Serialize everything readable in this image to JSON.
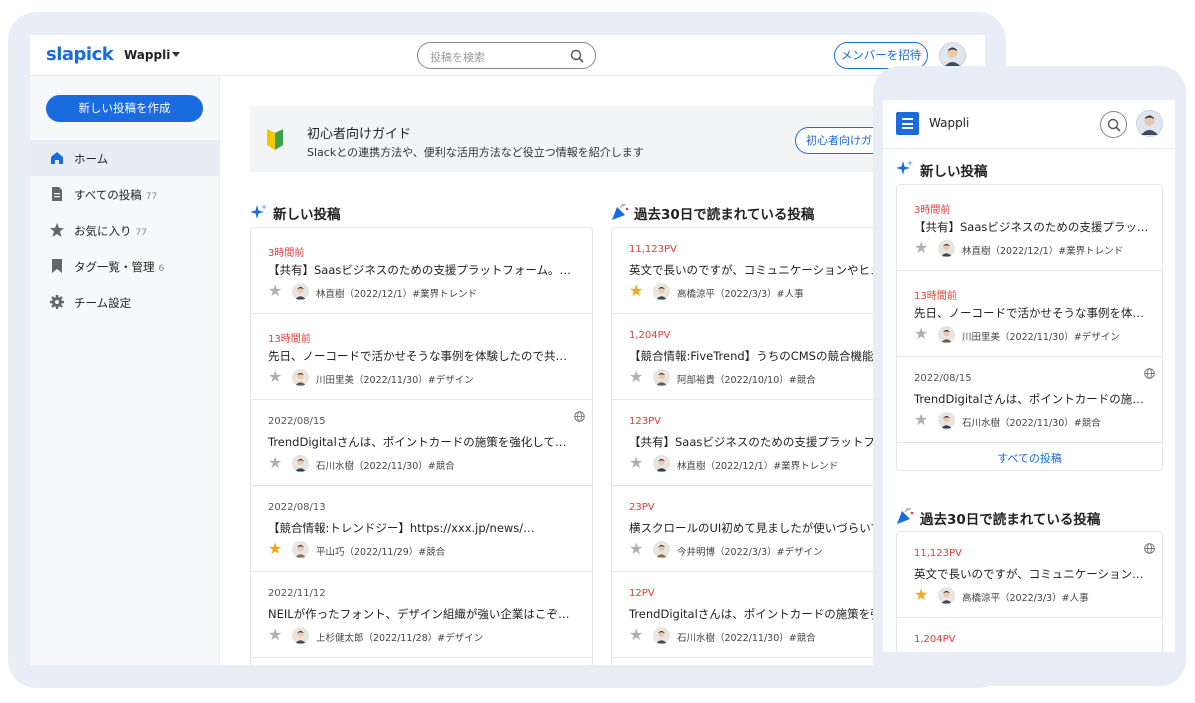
{
  "colors": {
    "brand": "#1a6be0",
    "recent_red": "#e03b3b",
    "star_on": "#f0a81c",
    "star_off": "#b0b0b0"
  },
  "desktop": {
    "logo": "slapick",
    "workspace": "Wappli",
    "search_placeholder": "投稿を検索",
    "invite_label": "メンバーを招待",
    "sidebar": {
      "new_post_label": "新しい投稿を作成",
      "items": [
        {
          "label": "ホーム",
          "count": "",
          "icon": "home-icon",
          "active": true
        },
        {
          "label": "すべての投稿",
          "count": "77",
          "icon": "document-icon",
          "active": false
        },
        {
          "label": "お気に入り",
          "count": "77",
          "icon": "star-icon",
          "active": false
        },
        {
          "label": "タグ一覧・管理",
          "count": "6",
          "icon": "bookmark-icon",
          "active": false
        },
        {
          "label": "チーム設定",
          "count": "",
          "icon": "gear-icon",
          "active": false
        }
      ]
    },
    "guide": {
      "title": "初心者向けガイド",
      "subtitle": "Slackとの連携方法や、便利な活用方法など役立つ情報を紹介します",
      "button_label": "初心者向けガイドを見る"
    },
    "new_posts": {
      "title": "新しい投稿",
      "items": [
        {
          "meta": "3時間前",
          "red": true,
          "title": "【共有】Saasビジネスのための支援プラットフォーム。…",
          "starred": false,
          "byline": "林直樹（2022/12/1）#業界トレンド",
          "globe": false
        },
        {
          "meta": "13時間前",
          "red": true,
          "title": "先日、ノーコードで活かせそうな事例を体験したので共有します。…",
          "starred": false,
          "byline": "川田里美（2022/11/30）#デザイン",
          "globe": false
        },
        {
          "meta": "2022/08/15",
          "red": false,
          "title": "TrendDigitalさんは、ポイントカードの施策を強化しているん…",
          "starred": false,
          "byline": "石川水樹（2022/11/30）#競合",
          "globe": true
        },
        {
          "meta": "2022/08/13",
          "red": false,
          "title": "【競合情報:トレンドジー】https://xxx.jp/news/…",
          "starred": true,
          "byline": "平山巧（2022/11/29）#競合",
          "globe": false
        },
        {
          "meta": "2022/11/12",
          "red": false,
          "title": "NEILが作ったフォント、デザイン組織が強い企業はこぞって作っ…",
          "starred": false,
          "byline": "上杉健太郎（2022/11/28）#デザイン",
          "globe": false
        }
      ]
    },
    "popular_posts": {
      "title": "過去30日で読まれている投稿",
      "items": [
        {
          "meta": "11,123PV",
          "red": true,
          "title": "英文で長いのですが、コミュニケーションやヒューマン",
          "starred": true,
          "byline": "高橋涼平（2022/3/3）#人事"
        },
        {
          "meta": "1,204PV",
          "red": true,
          "title": "【競合情報:FiveTrend】うちのCMSの競合機能とし",
          "starred": false,
          "byline": "阿部裕貴（2022/10/10）#競合"
        },
        {
          "meta": "123PV",
          "red": true,
          "title": "【共有】Saasビジネスのための支援プラットフォーム。",
          "starred": false,
          "byline": "林直樹（2022/12/1）#業界トレンド"
        },
        {
          "meta": "23PV",
          "red": true,
          "title": "横スクロールのUI初めて見ましたが使いづらいですよ",
          "starred": false,
          "byline": "今井明博（2022/3/3）#デザイン"
        },
        {
          "meta": "12PV",
          "red": true,
          "title": "TrendDigitalさんは、ポイントカードの施策を強化し",
          "starred": false,
          "byline": "石川水樹（2022/11/30）#競合"
        }
      ]
    }
  },
  "mobile": {
    "workspace": "Wappli",
    "new_posts": {
      "title": "新しい投稿",
      "items": [
        {
          "meta": "3時間前",
          "red": true,
          "title": "【共有】Saasビジネスのための支援プラットフォ…",
          "starred": false,
          "byline": "林直樹（2022/12/1）#業界トレンド",
          "globe": false
        },
        {
          "meta": "13時間前",
          "red": true,
          "title": "先日、ノーコードで活かせそうな事例を体験した…",
          "starred": false,
          "byline": "川田里美（2022/11/30）#デザイン",
          "globe": false
        },
        {
          "meta": "2022/08/15",
          "red": false,
          "title": "TrendDigitalさんは、ポイントカードの施策を…",
          "starred": false,
          "byline": "石川水樹（2022/11/30）#競合",
          "globe": true
        }
      ],
      "all_label": "すべての投稿"
    },
    "popular_posts": {
      "title": "過去30日で読まれている投稿",
      "items": [
        {
          "meta": "11,123PV",
          "red": true,
          "title": "英文で長いのですが、コミュニケーションやヒュ…",
          "starred": true,
          "byline": "高橋涼平（2022/3/3）#人事",
          "globe": true
        },
        {
          "meta": "1,204PV",
          "red": true,
          "title": "",
          "starred": false,
          "byline": "",
          "globe": false
        }
      ]
    }
  }
}
